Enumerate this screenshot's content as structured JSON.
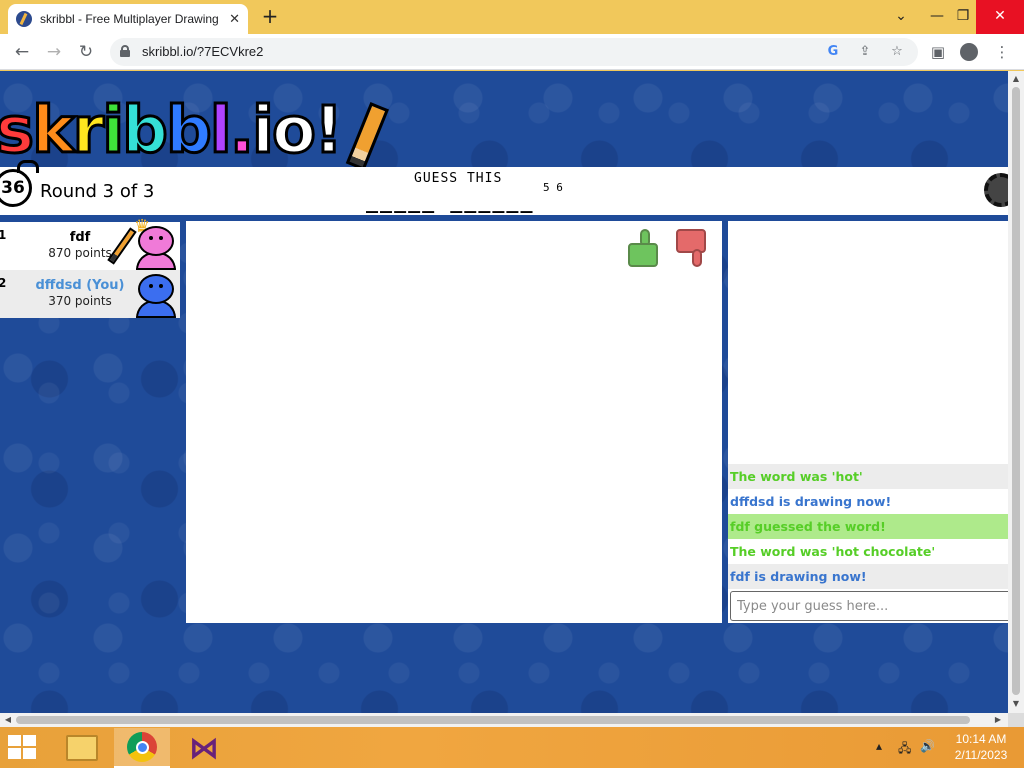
{
  "browser": {
    "tab_title": "skribbl - Free Multiplayer Drawing",
    "tab_close": "✕",
    "new_tab": "+",
    "url": "skribbl.io/?7ECVkre2",
    "window_controls": {
      "chevron": "⌄",
      "minimize": "—",
      "maximize": "❐",
      "close": "✕"
    },
    "nav": {
      "back": "←",
      "forward": "→",
      "reload": "↻"
    }
  },
  "game": {
    "logo_letters": [
      "s",
      "k",
      "r",
      "i",
      "b",
      "b",
      "l",
      ".",
      "i",
      "o",
      "!"
    ],
    "logo_colors": [
      "#ff3b3b",
      "#ff8c1a",
      "#ffe51f",
      "#3fe13a",
      "#35e0d6",
      "#2f7bff",
      "#b043ff",
      "#ff4fd8",
      "#ffffff",
      "#ffffff",
      "#ffffff"
    ],
    "timer": "36",
    "round": "Round 3 of 3",
    "guess_label": "GUESS THIS",
    "hint": "_____ ______",
    "word_lengths": "5 6"
  },
  "players": [
    {
      "rank": "1",
      "name": "fdf",
      "points": "870 points",
      "avatar_color": "#f07ad8",
      "is_you": false
    },
    {
      "rank": "2",
      "name": "dffdsd (You)",
      "points": "370 points",
      "avatar_color": "#3b6ef0",
      "is_you": true
    }
  ],
  "chat": {
    "messages": [
      {
        "text": "The word was 'hot'",
        "color": "green",
        "bg": "grey"
      },
      {
        "text": "dffdsd is drawing now!",
        "color": "blue",
        "bg": "white"
      },
      {
        "text": "fdf guessed the word!",
        "color": "green",
        "bg": "lime"
      },
      {
        "text": "The word was 'hot chocolate'",
        "color": "green",
        "bg": "white"
      },
      {
        "text": "fdf is drawing now!",
        "color": "blue",
        "bg": "grey"
      }
    ],
    "input_placeholder": "Type your guess here..."
  },
  "taskbar": {
    "time": "10:14 AM",
    "date": "2/11/2023"
  }
}
